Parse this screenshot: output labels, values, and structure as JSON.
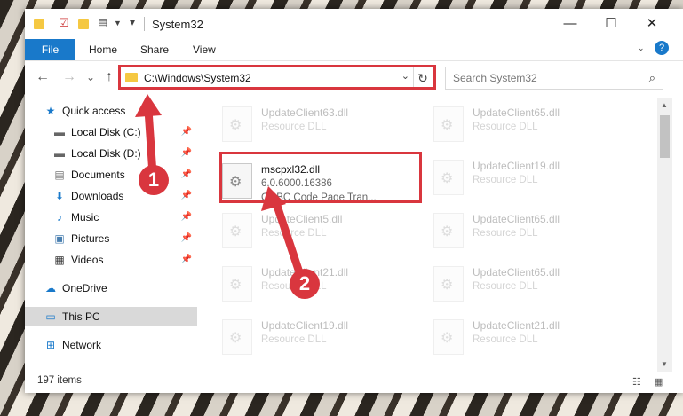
{
  "window": {
    "title": "System32",
    "controls": {
      "minimize": "—",
      "maximize": "☐",
      "close": "✕"
    }
  },
  "ribbon": {
    "file_tab": "File",
    "tabs": [
      "Home",
      "Share",
      "View"
    ],
    "help": "?"
  },
  "nav": {
    "back": "←",
    "forward": "→",
    "recent": "⌄",
    "up": "↑",
    "address": "C:\\Windows\\System32",
    "search_placeholder": "Search System32"
  },
  "sidebar": {
    "items": [
      {
        "label": "Quick access",
        "icon": "star-icon",
        "pinned": false
      },
      {
        "label": "Local Disk (C:)",
        "icon": "drive-icon",
        "pinned": true
      },
      {
        "label": "Local Disk (D:)",
        "icon": "drive-icon",
        "pinned": true
      },
      {
        "label": "Documents",
        "icon": "documents-icon",
        "pinned": true
      },
      {
        "label": "Downloads",
        "icon": "downloads-icon",
        "pinned": true
      },
      {
        "label": "Music",
        "icon": "music-icon",
        "pinned": true
      },
      {
        "label": "Pictures",
        "icon": "pictures-icon",
        "pinned": true
      },
      {
        "label": "Videos",
        "icon": "videos-icon",
        "pinned": true
      },
      {
        "label": "OneDrive",
        "icon": "onedrive-icon",
        "pinned": false
      },
      {
        "label": "This PC",
        "icon": "computer-icon",
        "pinned": false,
        "selected": true
      },
      {
        "label": "Network",
        "icon": "network-icon",
        "pinned": false
      }
    ]
  },
  "files": [
    {
      "name": "UpdateClient63.dll",
      "type": "Resource DLL"
    },
    {
      "name": "UpdateClient65.dll",
      "type": "Resource DLL"
    },
    {
      "name": "mscpxl32.dll",
      "version": "6.0.6000.16386",
      "description": "ODBC Code Page Tran...",
      "highlighted": true
    },
    {
      "name": "UpdateClient19.dll",
      "type": "Resource DLL"
    },
    {
      "name": "UpdateClient5.dll",
      "type": "Resource DLL"
    },
    {
      "name": "UpdateClient65.dll",
      "type": "Resource DLL"
    },
    {
      "name": "UpdateClient21.dll",
      "type": "Resource DLL"
    },
    {
      "name": "UpdateClient65.dll",
      "type": "Resource DLL"
    },
    {
      "name": "UpdateClient19.dll",
      "type": "Resource DLL"
    },
    {
      "name": "UpdateClient21.dll",
      "type": "Resource DLL"
    }
  ],
  "status": {
    "item_count": "197 items"
  },
  "callouts": {
    "step1": "1",
    "step2": "2"
  },
  "colors": {
    "accent": "#1979ca",
    "highlight_red": "#d9363e",
    "folder": "#f5c842"
  }
}
